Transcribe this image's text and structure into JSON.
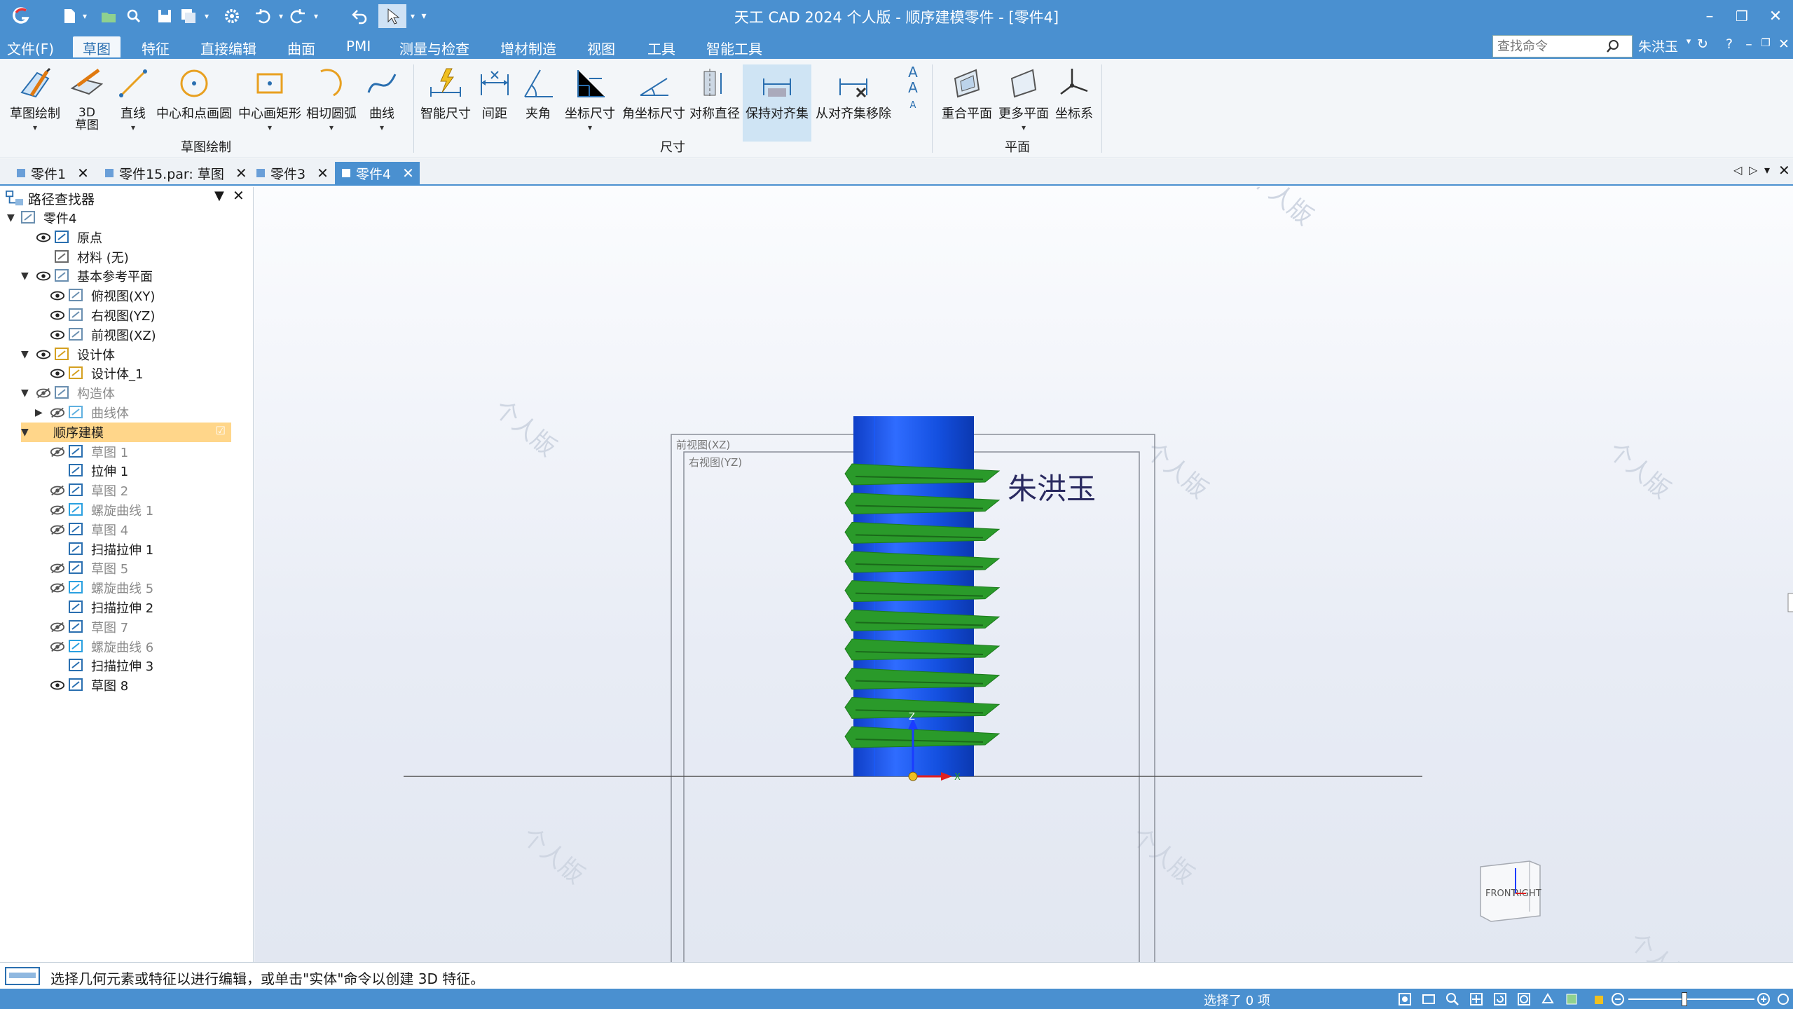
{
  "window": {
    "title": "天工 CAD 2024 个人版 - 顺序建模零件 - [零件4]"
  },
  "menu": {
    "items": [
      "文件(F)",
      "草图",
      "特征",
      "直接编辑",
      "曲面",
      "PMI",
      "测量与检查",
      "增材制造",
      "视图",
      "工具",
      "智能工具"
    ],
    "active": "草图",
    "search_placeholder": "查找命令",
    "user": "朱洪玉",
    "help": "?"
  },
  "ribbon": {
    "groups": [
      {
        "label": "草图绘制",
        "buttons": [
          {
            "label": "草图绘制",
            "icon": "sketch-draw-icon"
          },
          {
            "label": "3D\n草图",
            "icon": "sketch-3d-icon"
          },
          {
            "label": "直线",
            "icon": "line-icon"
          },
          {
            "label": "中心和点画圆",
            "icon": "circle-center-icon"
          },
          {
            "label": "中心画矩形",
            "icon": "rectangle-center-icon"
          },
          {
            "label": "相切圆弧",
            "icon": "tangent-arc-icon"
          },
          {
            "label": "曲线",
            "icon": "curve-icon"
          }
        ]
      },
      {
        "label": "尺寸",
        "buttons": [
          {
            "label": "智能尺寸",
            "icon": "smart-dimension-icon"
          },
          {
            "label": "间距",
            "icon": "distance-icon"
          },
          {
            "label": "夹角",
            "icon": "angle-icon"
          },
          {
            "label": "坐标尺寸",
            "icon": "coordinate-dimension-icon"
          },
          {
            "label": "角坐标尺寸",
            "icon": "angular-coordinate-icon"
          },
          {
            "label": "对称直径",
            "icon": "symmetric-diameter-icon"
          },
          {
            "label": "保持对齐集",
            "icon": "keep-alignment-icon"
          },
          {
            "label": "从对齐集移除",
            "icon": "remove-alignment-icon"
          }
        ]
      },
      {
        "label": "平面",
        "buttons": [
          {
            "label": "重合平面",
            "icon": "coincident-plane-icon"
          },
          {
            "label": "更多平面",
            "icon": "more-planes-icon"
          },
          {
            "label": "坐标系",
            "icon": "coordinate-system-icon"
          }
        ]
      }
    ]
  },
  "doc_tabs": [
    {
      "label": "零件1",
      "active": false
    },
    {
      "label": "零件15.par: 草图",
      "active": false
    },
    {
      "label": "零件3",
      "active": false
    },
    {
      "label": "零件4",
      "active": true
    }
  ],
  "pathfinder": {
    "title": "路径查找器",
    "tree": [
      {
        "label": "零件4",
        "level": 0,
        "expanded": true,
        "eye": "none",
        "icon": "part-icon",
        "dim": false
      },
      {
        "label": "原点",
        "level": 1,
        "eye": "visible",
        "icon": "origin-icon",
        "dim": false
      },
      {
        "label": "材料 (无)",
        "level": 1,
        "eye": "none",
        "icon": "material-icon",
        "dim": false
      },
      {
        "label": "基本参考平面",
        "level": 1,
        "expanded": true,
        "eye": "visible",
        "icon": "ref-plane-icon",
        "dim": false
      },
      {
        "label": "俯视图(XY)",
        "level": 2,
        "eye": "visible",
        "icon": "ref-plane-icon",
        "dim": false
      },
      {
        "label": "右视图(YZ)",
        "level": 2,
        "eye": "visible",
        "icon": "ref-plane-icon",
        "dim": false
      },
      {
        "label": "前视图(XZ)",
        "level": 2,
        "eye": "visible",
        "icon": "ref-plane-icon",
        "dim": false
      },
      {
        "label": "设计体",
        "level": 1,
        "expanded": true,
        "eye": "visible",
        "icon": "design-body-icon",
        "dim": false
      },
      {
        "label": "设计体_1",
        "level": 2,
        "eye": "visible",
        "icon": "body-icon",
        "dim": false
      },
      {
        "label": "构造体",
        "level": 1,
        "expanded": true,
        "eye": "hidden",
        "icon": "construction-icon",
        "dim": true
      },
      {
        "label": "曲线体",
        "level": 2,
        "expanded": false,
        "eye": "hidden",
        "icon": "curve-body-icon",
        "dim": true
      },
      {
        "label": "顺序建模",
        "level": 1,
        "expanded": true,
        "eye": "none",
        "icon": "none",
        "dim": false,
        "highlight": true
      },
      {
        "label": "草图 1",
        "level": 2,
        "eye": "hidden",
        "icon": "sketch-icon",
        "dim": true
      },
      {
        "label": "拉伸 1",
        "level": 2,
        "eye": "none",
        "icon": "extrude-icon",
        "dim": false
      },
      {
        "label": "草图 2",
        "level": 2,
        "eye": "hidden",
        "icon": "sketch-icon",
        "dim": true
      },
      {
        "label": "螺旋曲线 1",
        "level": 2,
        "eye": "hidden",
        "icon": "helix-icon",
        "dim": true
      },
      {
        "label": "草图 4",
        "level": 2,
        "eye": "hidden",
        "icon": "sketch-icon",
        "dim": true
      },
      {
        "label": "扫描拉伸 1",
        "level": 2,
        "eye": "none",
        "icon": "sweep-icon",
        "dim": false
      },
      {
        "label": "草图 5",
        "level": 2,
        "eye": "hidden",
        "icon": "sketch-icon",
        "dim": true
      },
      {
        "label": "螺旋曲线 5",
        "level": 2,
        "eye": "hidden",
        "icon": "helix-icon",
        "dim": true
      },
      {
        "label": "扫描拉伸 2",
        "level": 2,
        "eye": "none",
        "icon": "sweep-icon",
        "dim": false
      },
      {
        "label": "草图 7",
        "level": 2,
        "eye": "hidden",
        "icon": "sketch-icon",
        "dim": true
      },
      {
        "label": "螺旋曲线 6",
        "level": 2,
        "eye": "hidden",
        "icon": "helix-icon",
        "dim": true
      },
      {
        "label": "扫描拉伸 3",
        "level": 2,
        "eye": "none",
        "icon": "sweep-icon",
        "dim": false
      },
      {
        "label": "草图 8",
        "level": 2,
        "eye": "visible",
        "icon": "sketch-icon",
        "dim": false
      }
    ]
  },
  "viewport": {
    "front_plane_label": "前视图(XZ)",
    "right_plane_label": "右视图(YZ)",
    "annotation_text": "朱洪玉",
    "view_cube": {
      "front": "FRONT",
      "right": "RIGHT"
    },
    "watermark": "个人版",
    "axis_labels": {
      "x": "X",
      "z": "Z"
    },
    "thread_turns": 10,
    "colors": {
      "cylinder": "#1450e0",
      "thread": "#2a9a2a",
      "axis_z": "#1a3cff",
      "axis_x": "#e02020"
    }
  },
  "status": {
    "prompt": "选择几何元素或特征以进行编辑，或单击\"实体\"命令以创建 3D 特征。",
    "selection": "选择了 0 项"
  }
}
